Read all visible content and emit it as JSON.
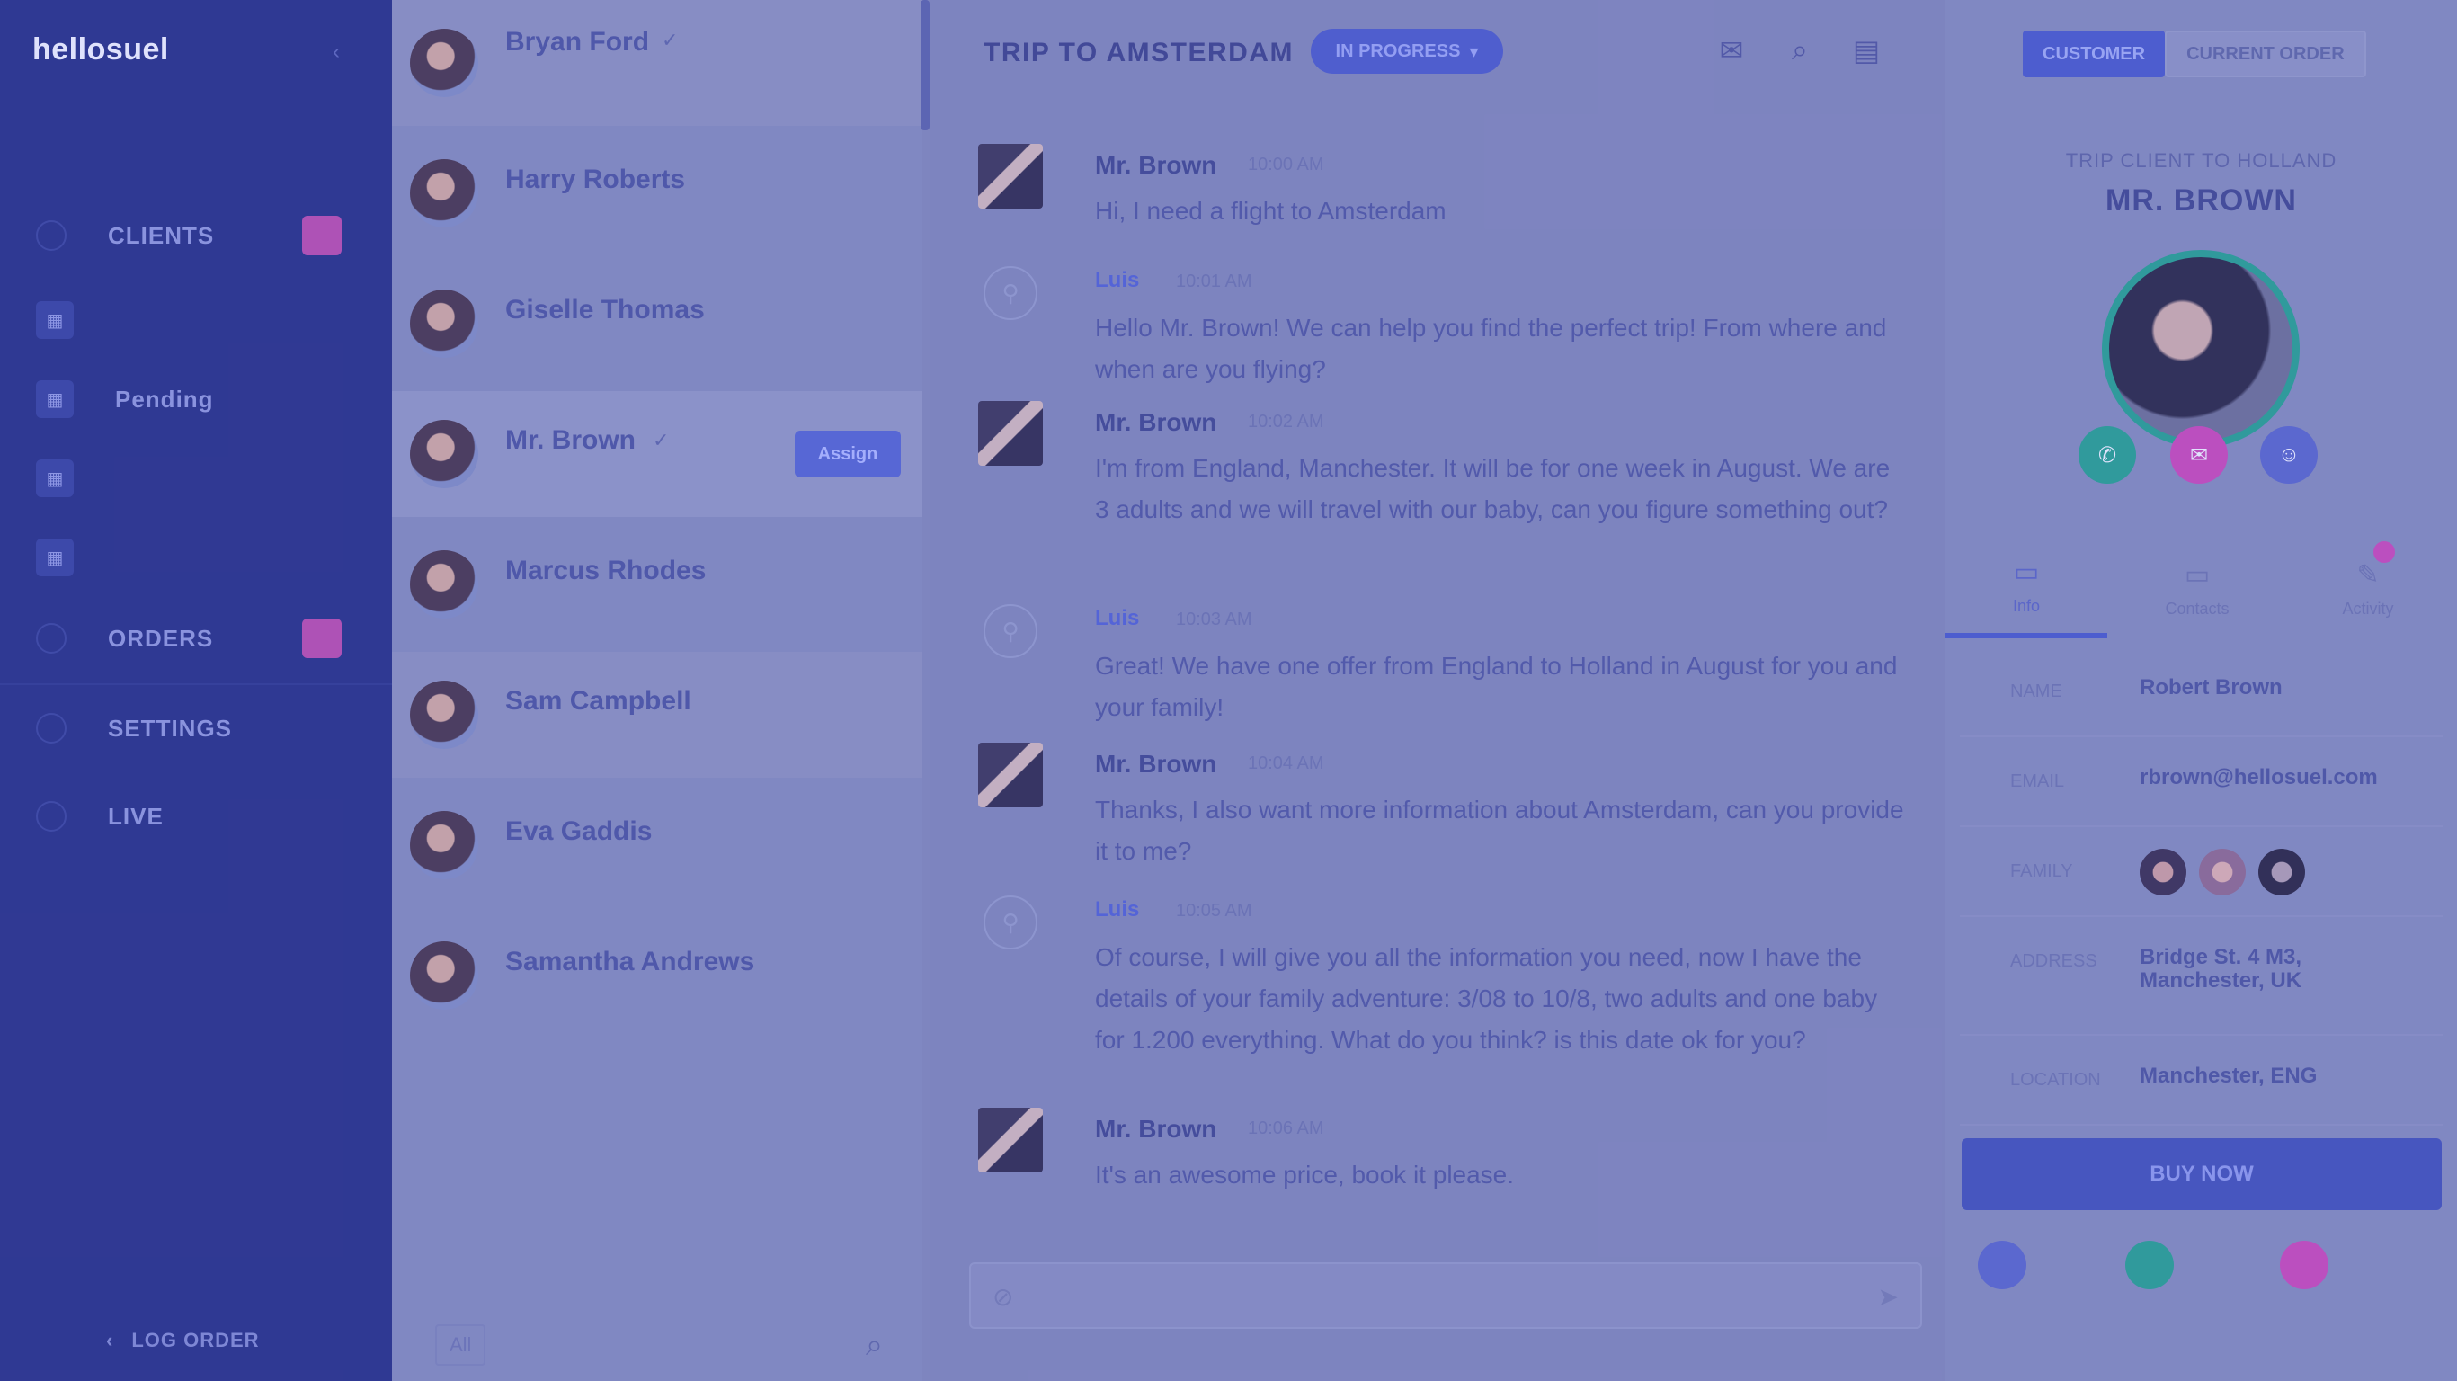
{
  "nav": {
    "brand": "hellosuel",
    "brand_sub": "",
    "items": [
      {
        "label": "CLIENTS",
        "badge": ""
      },
      {
        "label": "",
        "badge": ""
      },
      {
        "label": "Pending",
        "badge": ""
      },
      {
        "label": "",
        "badge": ""
      },
      {
        "label": "",
        "badge": ""
      },
      {
        "label": "ORDERS",
        "badge": ""
      },
      {
        "label": "SETTINGS",
        "badge": ""
      },
      {
        "label": "LIVE",
        "badge": ""
      }
    ],
    "logout": "LOG ORDER"
  },
  "conversations": [
    {
      "name": "Bryan Ford",
      "sub": ""
    },
    {
      "name": "Harry Roberts",
      "sub": ""
    },
    {
      "name": "Giselle Thomas",
      "sub": ""
    },
    {
      "name": "Mr. Brown",
      "sub": "",
      "tag": "Assign"
    },
    {
      "name": "Marcus Rhodes",
      "sub": ""
    },
    {
      "name": "Sam Campbell",
      "sub": ""
    },
    {
      "name": "Eva Gaddis",
      "sub": ""
    },
    {
      "name": "Samantha Andrews",
      "sub": ""
    }
  ],
  "convlist_footer": {
    "filter": "All"
  },
  "chat": {
    "title": "TRIP TO AMSTERDAM",
    "status": "IN PROGRESS",
    "messages": [
      {
        "author": "Mr. Brown",
        "time": "10:00 AM",
        "text": "Hi, I need a flight to Amsterdam",
        "bot": false
      },
      {
        "author": "Luis",
        "time": "10:01 AM",
        "text": "Hello Mr. Brown! We can help you find the perfect trip! From where and when are you flying?",
        "bot": true
      },
      {
        "author": "Mr. Brown",
        "time": "10:02 AM",
        "text": "I'm from England, Manchester. It will be for one week in August. We are 3 adults and we will travel with our baby, can you figure something out?",
        "bot": false
      },
      {
        "author": "Luis",
        "time": "10:03 AM",
        "text": "Great! We have one offer from England to Holland in August for you and your family!",
        "bot": true
      },
      {
        "author": "Mr. Brown",
        "time": "10:04 AM",
        "text": "Thanks, I also want more information about Amsterdam, can you provide it to me?",
        "bot": false
      },
      {
        "author": "Luis",
        "time": "10:05 AM",
        "text": "Of course, I will give you all the information you need, now I have the details of your family adventure: 3/08 to 10/8, two adults and one baby for 1.200 everything. What do you think? is this date ok for you?",
        "bot": true
      },
      {
        "author": "Mr. Brown",
        "time": "10:06 AM",
        "text": "It's an awesome price, book it please.",
        "bot": false
      }
    ],
    "composer_placeholder": ""
  },
  "info": {
    "tab_on": "CUSTOMER",
    "tab_off": "CURRENT ORDER",
    "caption": "TRIP CLIENT TO HOLLAND",
    "client_name": "MR. BROWN",
    "sections": [
      "Info",
      "Contacts",
      "Activity"
    ],
    "fields": [
      {
        "k": "NAME",
        "v": "Robert Brown"
      },
      {
        "k": "EMAIL",
        "v": "rbrown@hellosuel.com"
      },
      {
        "k": "FAMILY",
        "v": ""
      },
      {
        "k": "ADDRESS",
        "v": "Bridge St. 4 M3, Manchester, UK"
      },
      {
        "k": "LOCATION",
        "v": "Manchester, ENG"
      }
    ],
    "button": "BUY NOW",
    "agents": [
      {
        "label": "",
        "color": "#5a66d0"
      },
      {
        "label": "",
        "color": "#2c9c9a"
      },
      {
        "label": "",
        "color": "#c04cbf"
      }
    ]
  },
  "colors": {
    "nav_bg": "#2b3590",
    "accent": "#4b5bd0",
    "pink": "#c04cbf",
    "teal": "#2c9c9a"
  }
}
